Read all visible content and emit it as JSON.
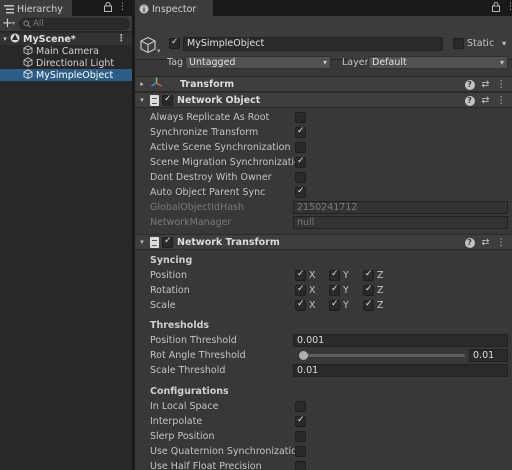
{
  "hierarchy": {
    "tab_label": "Hierarchy",
    "search_placeholder": "All",
    "add_symbol": "+",
    "caret_symbol": "▾",
    "scene": {
      "name": "MyScene*",
      "arrow": "▾"
    },
    "items": [
      {
        "label": "Main Camera"
      },
      {
        "label": "Directional Light"
      },
      {
        "label": "MySimpleObject"
      }
    ],
    "selected_index": 2
  },
  "inspector": {
    "tab_label": "Inspector",
    "object_name": "MySimpleObject",
    "object_enabled": true,
    "static_label": "Static",
    "static_checked": false,
    "static_caret": "▾",
    "tag_label": "Tag",
    "tag_value": "Untagged",
    "layer_label": "Layer",
    "layer_value": "Default",
    "icons": {
      "help": "?",
      "settings": "⇄",
      "kebab": "⋮",
      "lock": "🔒"
    }
  },
  "transform": {
    "title": "Transform",
    "arrow": "▸"
  },
  "network_object": {
    "title": "Network Object",
    "arrow": "▾",
    "enabled": true,
    "rows": [
      {
        "label": "Always Replicate As Root",
        "checked": false
      },
      {
        "label": "Synchronize Transform",
        "checked": true
      },
      {
        "label": "Active Scene Synchronization",
        "checked": false
      },
      {
        "label": "Scene Migration Synchronization",
        "checked": true
      },
      {
        "label": "Dont Destroy With Owner",
        "checked": false
      },
      {
        "label": "Auto Object Parent Sync",
        "checked": true
      }
    ],
    "readonly_rows": [
      {
        "label": "GlobalObjectIdHash",
        "value": "2150241712"
      },
      {
        "label": "NetworkManager",
        "value": "null"
      }
    ]
  },
  "network_transform": {
    "title": "Network Transform",
    "arrow": "▾",
    "enabled": true,
    "syncing_header": "Syncing",
    "axes": [
      "X",
      "Y",
      "Z"
    ],
    "syncing": [
      {
        "label": "Position",
        "x": true,
        "y": true,
        "z": true
      },
      {
        "label": "Rotation",
        "x": true,
        "y": true,
        "z": true
      },
      {
        "label": "Scale",
        "x": true,
        "y": true,
        "z": true
      }
    ],
    "thresholds_header": "Thresholds",
    "position_threshold": {
      "label": "Position Threshold",
      "value": "0.001"
    },
    "rot_angle_threshold": {
      "label": "Rot Angle Threshold",
      "value": "0.01",
      "slider_fraction": 0.0
    },
    "scale_threshold": {
      "label": "Scale Threshold",
      "value": "0.01"
    },
    "configurations_header": "Configurations",
    "configurations": [
      {
        "label": "In Local Space",
        "checked": false
      },
      {
        "label": "Interpolate",
        "checked": true
      },
      {
        "label": "Slerp Position",
        "checked": false
      },
      {
        "label": "Use Quaternion Synchronization",
        "checked": false
      },
      {
        "label": "Use Half Float Precision",
        "checked": false
      }
    ]
  }
}
